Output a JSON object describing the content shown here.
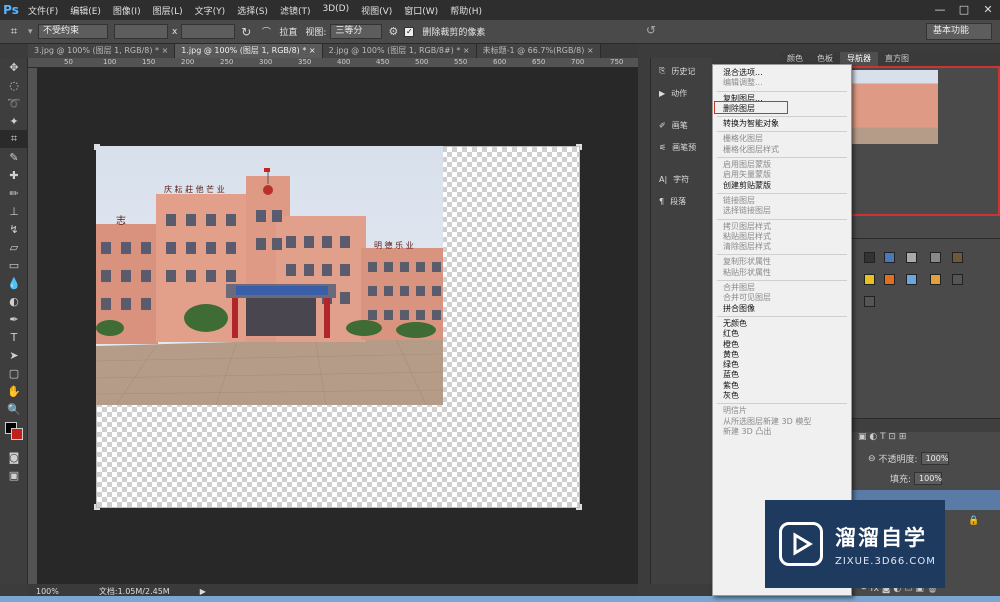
{
  "app": {
    "logo": "Ps",
    "win_controls": [
      "—",
      "□",
      "✕"
    ]
  },
  "menu": [
    "文件(F)",
    "编辑(E)",
    "图像(I)",
    "图层(L)",
    "文字(Y)",
    "选择(S)",
    "滤镜(T)",
    "3D(D)",
    "视图(V)",
    "窗口(W)",
    "帮助(H)"
  ],
  "options": {
    "ratio": "不受约束",
    "x": "x",
    "straighten": "拉直",
    "view_label": "视图:",
    "view_value": "三等分",
    "delete_cropped": "删除裁剪的像素",
    "workspace": "基本功能"
  },
  "tabs": [
    {
      "label": "3.jpg @ 100% (图层 1, RGB/8) *",
      "close": "×"
    },
    {
      "label": "1.jpg @ 100% (图层 1, RGB/8) *",
      "close": "×"
    },
    {
      "label": "2.jpg @ 100% (图层 1, RGB/8#) *",
      "close": "×"
    },
    {
      "label": "未标题-1 @ 66.7%(RGB/8)",
      "close": "×"
    }
  ],
  "ruler_ticks": [
    "50",
    "100",
    "150",
    "200",
    "250",
    "300",
    "350",
    "400",
    "450",
    "500",
    "550",
    "600",
    "650",
    "700",
    "750"
  ],
  "status": {
    "zoom": "100%",
    "doc": "文档:1.05M/2.45M"
  },
  "collapsed_panels": [
    "历史记",
    "动作",
    "画笔",
    "画笔预",
    "字符",
    "段落"
  ],
  "panel_tabs": [
    "颜色",
    "色板",
    "导航器",
    "直方图"
  ],
  "layers_panel": {
    "opacity_label": "不透明度:",
    "opacity_value": "100%",
    "fill_label": "填充:",
    "fill_value": "100%"
  },
  "photo_signs": {
    "top": "庆 耘 莊 他 芒 业",
    "side": "明 德 乐 业",
    "left": "志"
  },
  "context_menu": [
    {
      "label": "混合选项...",
      "disabled": false
    },
    {
      "label": "编辑调整...",
      "disabled": true
    },
    {
      "sep": true
    },
    {
      "label": "复制图层...",
      "disabled": false,
      "highlighted": true
    },
    {
      "label": "删除图层",
      "disabled": false
    },
    {
      "sep": true
    },
    {
      "label": "转换为智能对象",
      "disabled": false
    },
    {
      "sep": true
    },
    {
      "label": "栅格化图层",
      "disabled": true
    },
    {
      "label": "栅格化图层样式",
      "disabled": true
    },
    {
      "sep": true
    },
    {
      "label": "启用图层蒙版",
      "disabled": true
    },
    {
      "label": "启用矢量蒙版",
      "disabled": true
    },
    {
      "label": "创建剪贴蒙版",
      "disabled": false
    },
    {
      "sep": true
    },
    {
      "label": "链接图层",
      "disabled": true
    },
    {
      "label": "选择链接图层",
      "disabled": true
    },
    {
      "sep": true
    },
    {
      "label": "拷贝图层样式",
      "disabled": true
    },
    {
      "label": "粘贴图层样式",
      "disabled": true
    },
    {
      "label": "清除图层样式",
      "disabled": true
    },
    {
      "sep": true
    },
    {
      "label": "复制形状属性",
      "disabled": true
    },
    {
      "label": "粘贴形状属性",
      "disabled": true
    },
    {
      "sep": true
    },
    {
      "label": "合并图层",
      "disabled": true
    },
    {
      "label": "合并可见图层",
      "disabled": true
    },
    {
      "label": "拼合图像",
      "disabled": false
    },
    {
      "sep": true
    },
    {
      "label": "无颜色",
      "disabled": false
    },
    {
      "label": "红色",
      "disabled": false
    },
    {
      "label": "橙色",
      "disabled": false
    },
    {
      "label": "黄色",
      "disabled": false
    },
    {
      "label": "绿色",
      "disabled": false
    },
    {
      "label": "蓝色",
      "disabled": false
    },
    {
      "label": "紫色",
      "disabled": false
    },
    {
      "label": "灰色",
      "disabled": false
    },
    {
      "sep": true
    },
    {
      "label": "明信片",
      "disabled": true
    },
    {
      "label": "从所选图层新建 3D 模型",
      "disabled": true
    },
    {
      "label": "新建 3D 凸出",
      "disabled": true
    }
  ],
  "watermark": {
    "brand": "溜溜自学",
    "url": "ZIXUE.3D66.COM"
  },
  "colors": {
    "accent": "#c0392b",
    "selection": "#5a7ba6",
    "watermark_bg": "#1f3a5f"
  }
}
